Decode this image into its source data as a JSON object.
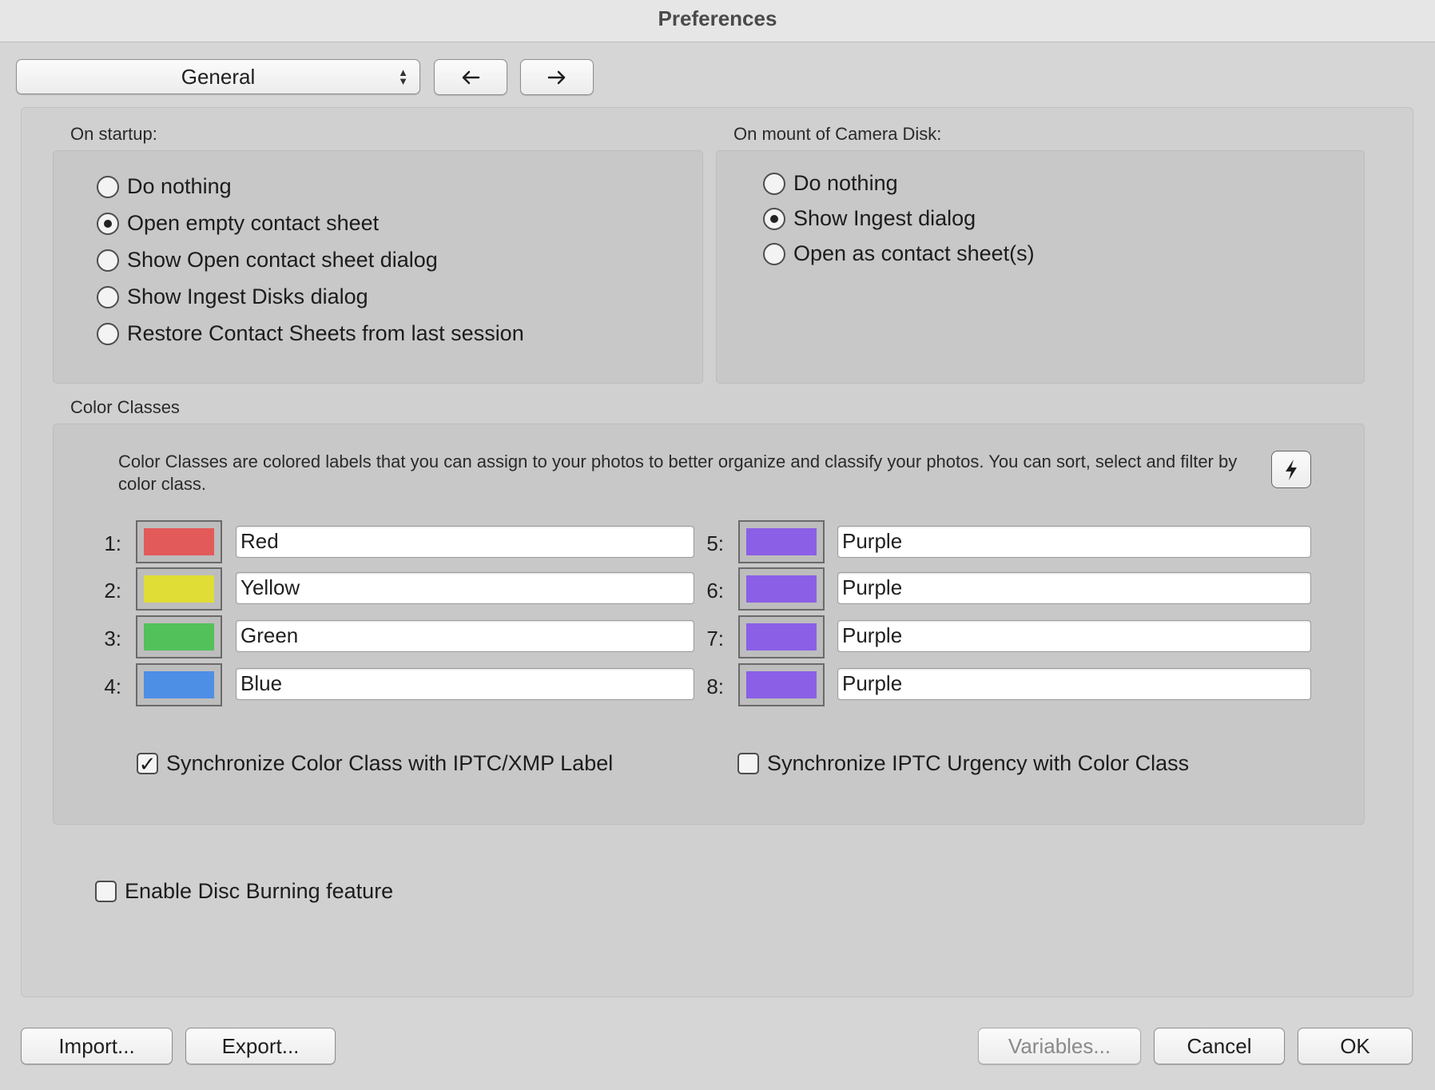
{
  "window": {
    "title": "Preferences"
  },
  "toolbar": {
    "category_select": "General",
    "back_icon": "arrow-left-icon",
    "forward_icon": "arrow-right-icon"
  },
  "startup": {
    "label": "On startup:",
    "options": [
      {
        "label": "Do nothing",
        "selected": false
      },
      {
        "label": "Open empty contact sheet",
        "selected": true
      },
      {
        "label": "Show Open contact sheet dialog",
        "selected": false
      },
      {
        "label": "Show Ingest Disks dialog",
        "selected": false
      },
      {
        "label": "Restore Contact Sheets from last session",
        "selected": false
      }
    ]
  },
  "camera_disk": {
    "label": "On mount of Camera Disk:",
    "options": [
      {
        "label": "Do nothing",
        "selected": false
      },
      {
        "label": "Show Ingest dialog",
        "selected": true
      },
      {
        "label": "Open as contact sheet(s)",
        "selected": false
      }
    ]
  },
  "color_classes": {
    "label": "Color Classes",
    "description": "Color Classes are colored labels that you can assign to your photos to better organize and classify your photos.  You can sort, select and filter by color class.",
    "bolt_icon": "lightning-bolt-icon",
    "items": [
      {
        "num": "1:",
        "name": "Red",
        "color": "#e35a5a"
      },
      {
        "num": "2:",
        "name": "Yellow",
        "color": "#e0dd36"
      },
      {
        "num": "3:",
        "name": "Green",
        "color": "#52c15a"
      },
      {
        "num": "4:",
        "name": "Blue",
        "color": "#4e8fe6"
      },
      {
        "num": "5:",
        "name": "Purple",
        "color": "#8b5fe6"
      },
      {
        "num": "6:",
        "name": "Purple",
        "color": "#8b5fe6"
      },
      {
        "num": "7:",
        "name": "Purple",
        "color": "#8b5fe6"
      },
      {
        "num": "8:",
        "name": "Purple",
        "color": "#8b5fe6"
      }
    ],
    "sync_xmp": {
      "label": "Synchronize Color Class with IPTC/XMP Label",
      "checked": true
    },
    "sync_urgency": {
      "label": "Synchronize IPTC Urgency with Color Class",
      "checked": false
    }
  },
  "disc_burning": {
    "label": "Enable Disc Burning feature",
    "checked": false
  },
  "footer": {
    "import": "Import...",
    "export": "Export...",
    "variables": "Variables...",
    "cancel": "Cancel",
    "ok": "OK"
  }
}
